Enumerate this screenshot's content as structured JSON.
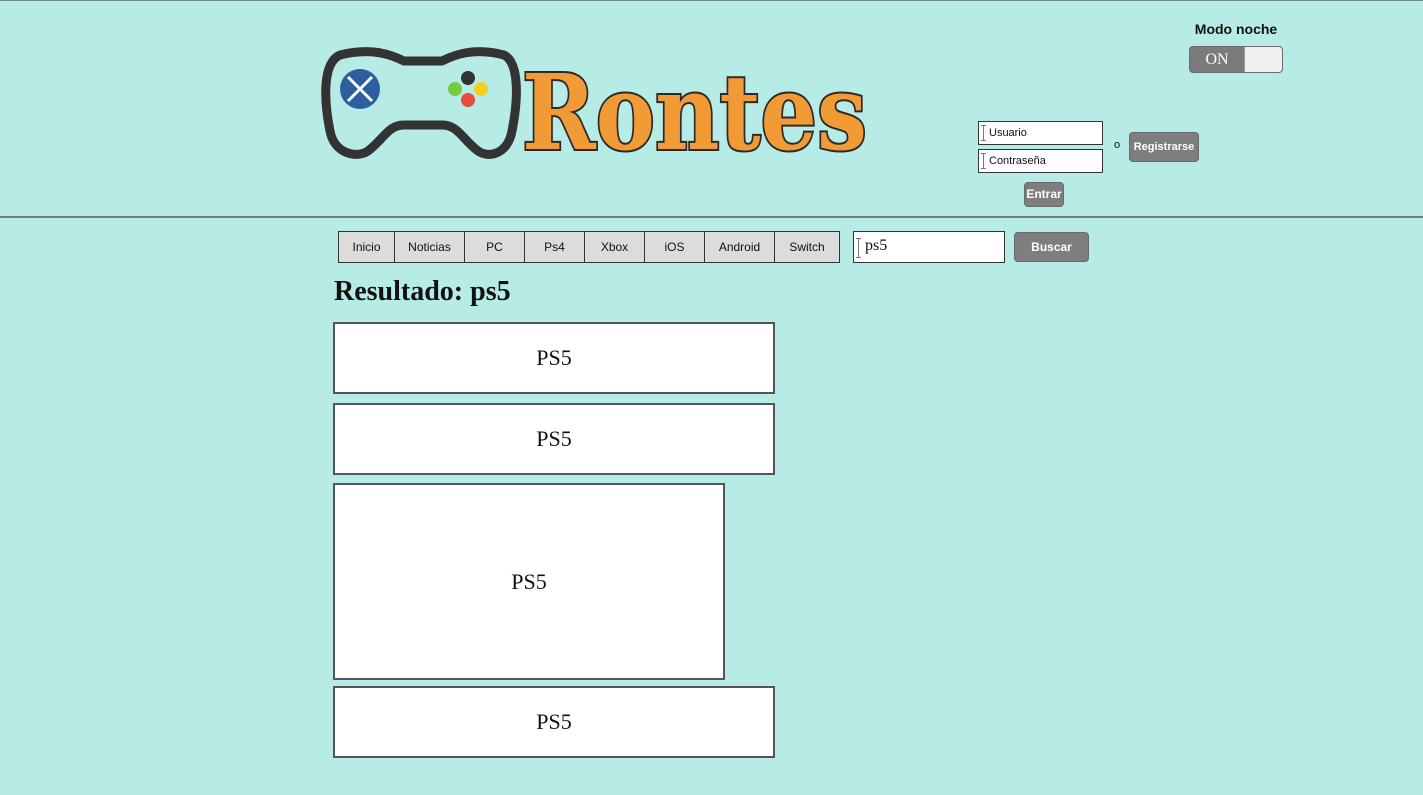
{
  "brand": {
    "name": "Rontes",
    "colors": {
      "accent": "#f29a35",
      "background": "#b7ece6"
    }
  },
  "night_mode": {
    "label": "Modo noche",
    "state": "ON"
  },
  "login": {
    "username_placeholder": "Usuario",
    "password_placeholder": "Contraseña",
    "or_text": "o",
    "register_label": "Registrarse",
    "enter_label": "Entrar"
  },
  "nav": {
    "items": [
      {
        "label": "Inicio"
      },
      {
        "label": "Noticias"
      },
      {
        "label": "PC"
      },
      {
        "label": "Ps4"
      },
      {
        "label": "Xbox"
      },
      {
        "label": "iOS"
      },
      {
        "label": "Android"
      },
      {
        "label": "Switch"
      }
    ]
  },
  "search": {
    "value": "ps5",
    "button_label": "Buscar"
  },
  "results": {
    "title": "Resultado: ps5",
    "items": [
      {
        "label": "PS5"
      },
      {
        "label": "PS5"
      },
      {
        "label": "PS5"
      },
      {
        "label": "PS5"
      }
    ]
  }
}
